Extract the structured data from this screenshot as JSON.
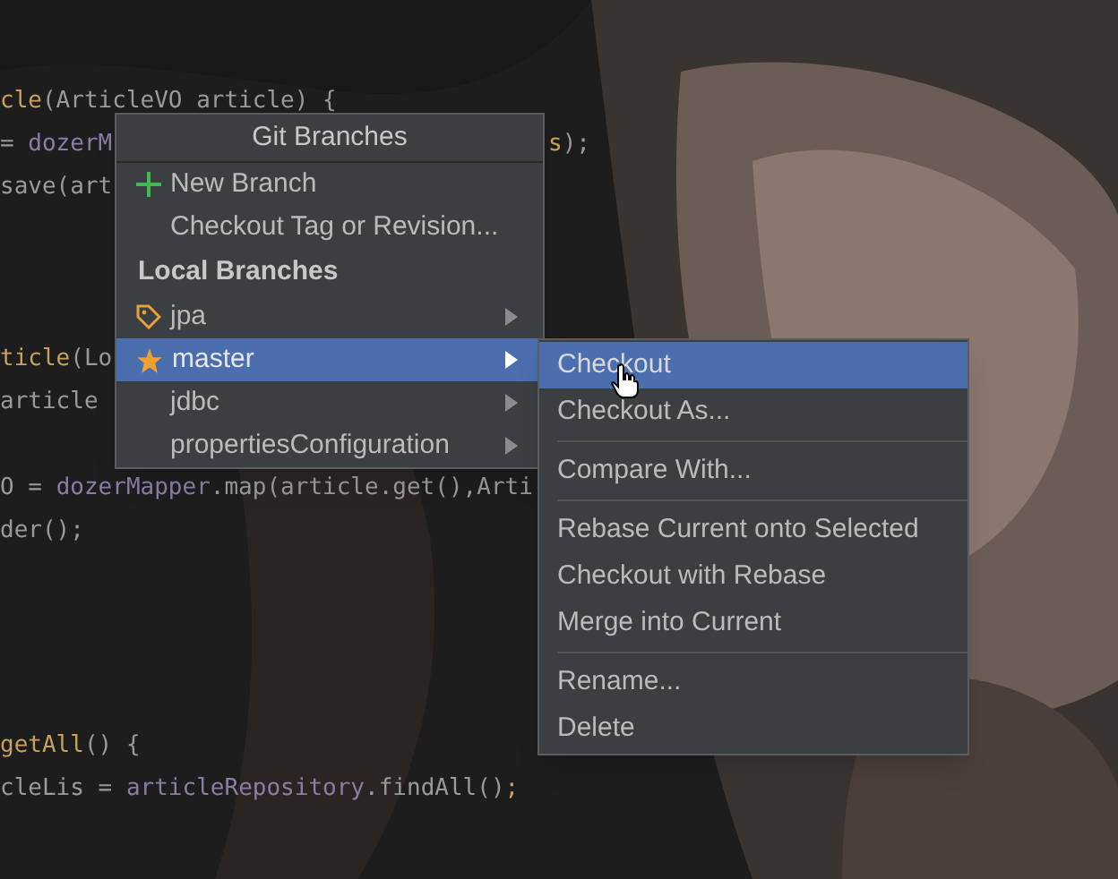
{
  "editor": {
    "lines": [
      {
        "segments": [
          {
            "text": "cle",
            "kind": "method"
          },
          {
            "text": "(ArticleVO article) {",
            "kind": "plain"
          }
        ]
      },
      {
        "segments": [
          {
            "text": "= ",
            "kind": "plain"
          },
          {
            "text": "dozerM",
            "kind": "field"
          }
        ],
        "after_popup": [
          {
            "text": "s",
            "kind": "method"
          },
          {
            "text": ");",
            "kind": "plain"
          }
        ]
      },
      {
        "segments": [
          {
            "text": "save(art",
            "kind": "plain"
          }
        ]
      },
      {
        "segments": [
          {
            "text": "ticle",
            "kind": "method"
          },
          {
            "text": "(Lo",
            "kind": "plain"
          }
        ]
      },
      {
        "segments": [
          {
            "text": "article",
            "kind": "plain"
          }
        ]
      },
      {
        "segments": [
          {
            "text": "O",
            "kind": "plain"
          },
          {
            "text": " = ",
            "kind": "plain"
          },
          {
            "text": "dozerMapper",
            "kind": "field"
          },
          {
            "text": ".map(article.get(),Arti",
            "kind": "plain"
          }
        ]
      },
      {
        "segments": [
          {
            "text": "der();",
            "kind": "plain"
          }
        ]
      },
      {
        "segments": [
          {
            "text": "getAll",
            "kind": "method"
          },
          {
            "text": "() {",
            "kind": "plain"
          }
        ]
      },
      {
        "segments": [
          {
            "text": "cleLis = ",
            "kind": "plain"
          },
          {
            "text": "articleRepository",
            "kind": "field"
          },
          {
            "text": ".findAll()",
            "kind": "plain"
          },
          {
            "text": ";",
            "kind": "method"
          }
        ]
      }
    ]
  },
  "branches_popup": {
    "title": "Git Branches",
    "items": [
      {
        "kind": "create",
        "label": "New Branch",
        "selected": false
      },
      {
        "kind": "action",
        "label": "Checkout Tag or Revision...",
        "selected": false
      },
      {
        "kind": "header",
        "label": "Local Branches"
      },
      {
        "kind": "current",
        "label": "jpa",
        "selected": false
      },
      {
        "kind": "favorite",
        "label": "master",
        "selected": true
      },
      {
        "kind": "branch",
        "label": "jdbc",
        "selected": false
      },
      {
        "kind": "branch",
        "label": "propertiesConfiguration",
        "selected": false
      }
    ]
  },
  "branch_actions_menu": {
    "groups": [
      [
        {
          "label": "Checkout",
          "selected": true
        },
        {
          "label": "Checkout As...",
          "selected": false
        }
      ],
      [
        {
          "label": "Compare With...",
          "selected": false
        }
      ],
      [
        {
          "label": "Rebase Current onto Selected",
          "selected": false
        },
        {
          "label": "Checkout with Rebase",
          "selected": false
        },
        {
          "label": "Merge into Current",
          "selected": false
        }
      ],
      [
        {
          "label": "Rename...",
          "selected": false
        },
        {
          "label": "Delete",
          "selected": false
        }
      ]
    ]
  }
}
